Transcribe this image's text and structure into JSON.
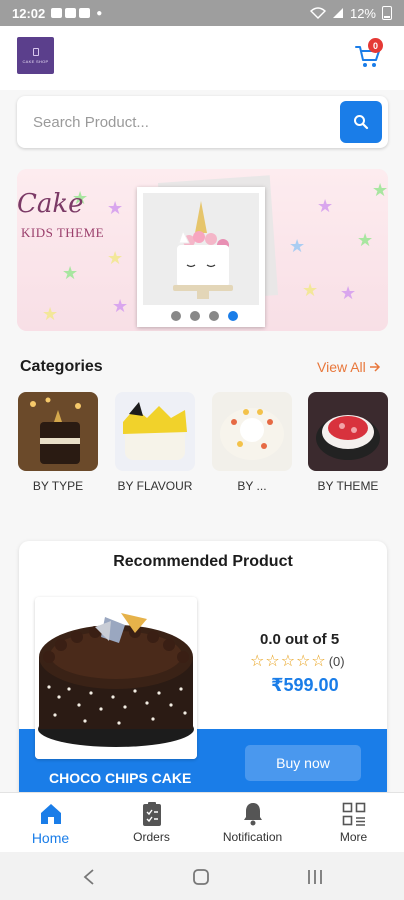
{
  "status_bar": {
    "time": "12:02",
    "battery": "12%"
  },
  "header": {
    "logo_text": "CAKE SHOP",
    "cart_count": "0"
  },
  "search": {
    "placeholder": "Search Product..."
  },
  "banner": {
    "title": "Cake",
    "subtitle": "KIDS THEME",
    "slide_count": 4,
    "active_slide": 4
  },
  "categories": {
    "title": "Categories",
    "view_all": "View All",
    "items": [
      {
        "label": "BY TYPE"
      },
      {
        "label": "BY FLAVOUR"
      },
      {
        "label": "BY ..."
      },
      {
        "label": "BY THEME"
      }
    ]
  },
  "recommended": {
    "title": "Recommended Product",
    "product_name": "CHOCO CHIPS CAKE",
    "rating_text": "0.0 out of 5",
    "rating_value": 0,
    "rating_count": "(0)",
    "price": "₹599.00",
    "buy_label": "Buy now"
  },
  "bottom_nav": [
    {
      "label": "Home",
      "icon": "home-icon",
      "active": true
    },
    {
      "label": "Orders",
      "icon": "orders-icon",
      "active": false
    },
    {
      "label": "Notification",
      "icon": "bell-icon",
      "active": false
    },
    {
      "label": "More",
      "icon": "grid-icon",
      "active": false
    }
  ],
  "colors": {
    "accent": "#1a7de8",
    "link": "#e8773b",
    "badge": "#e53935",
    "star": "#e8a11a"
  }
}
